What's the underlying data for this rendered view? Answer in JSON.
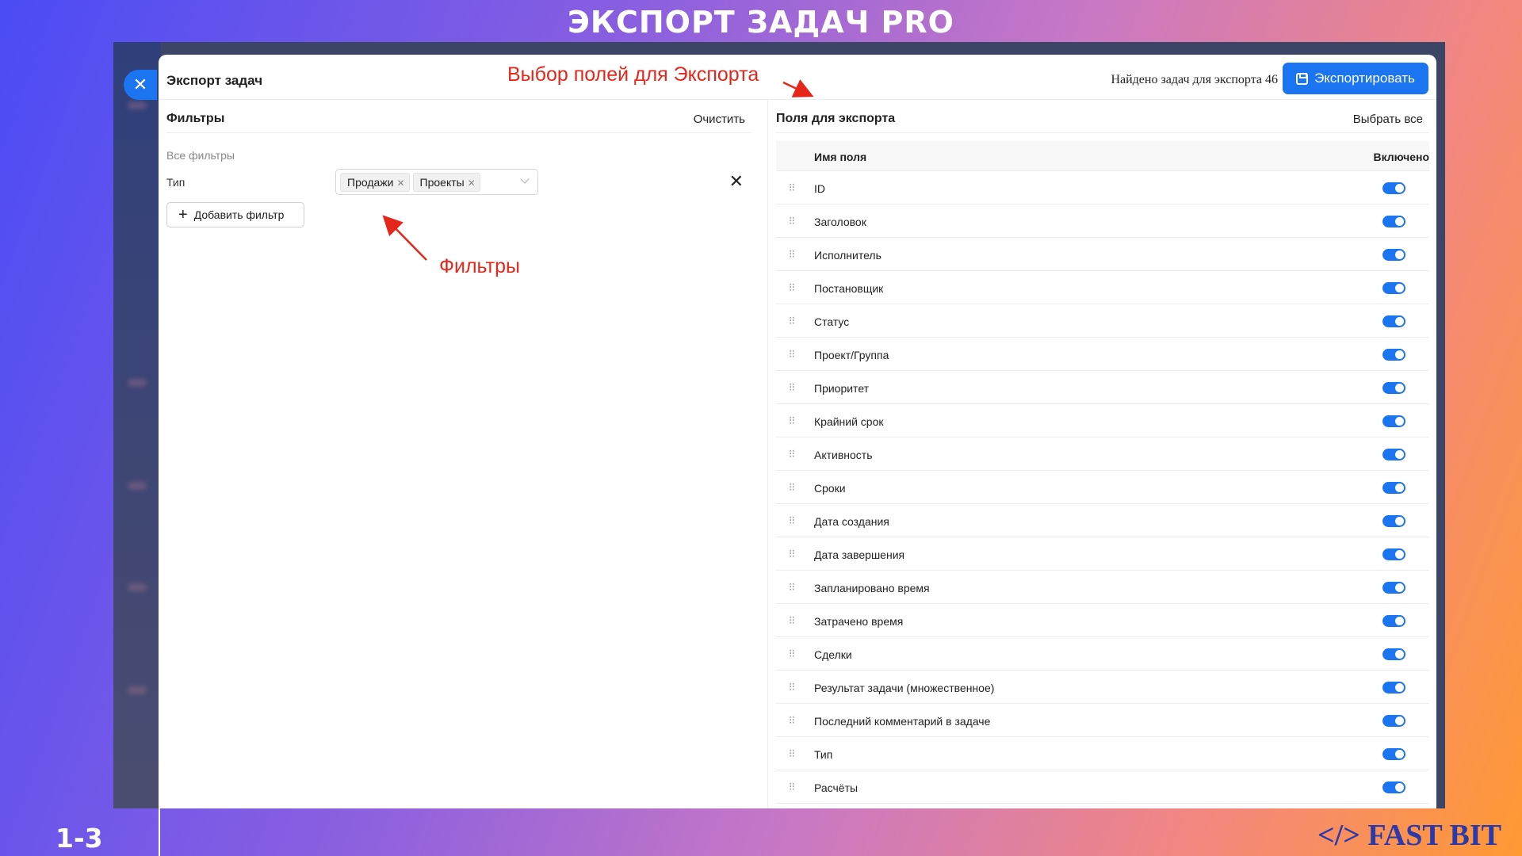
{
  "slide": {
    "title": "ЭКСПОРТ ЗАДАЧ PRO",
    "number": "1-3",
    "brand": "</> FAST BIT"
  },
  "header": {
    "title": "Экспорт задач",
    "found_text": "Найдено задач для экспорта 46",
    "export_label": "Экспортировать"
  },
  "filters": {
    "title": "Фильтры",
    "clear_label": "Очистить",
    "all_filters_label": "Все фильтры",
    "type_label": "Тип",
    "tags": [
      "Продажи",
      "Проекты"
    ],
    "add_filter_label": "Добавить фильтр"
  },
  "fields": {
    "title": "Поля для экспорта",
    "select_all_label": "Выбрать все",
    "col_name": "Имя поля",
    "col_enabled": "Включено",
    "items": [
      {
        "name": "ID",
        "enabled": true
      },
      {
        "name": "Заголовок",
        "enabled": true
      },
      {
        "name": "Исполнитель",
        "enabled": true
      },
      {
        "name": "Постановщик",
        "enabled": true
      },
      {
        "name": "Статус",
        "enabled": true
      },
      {
        "name": "Проект/Группа",
        "enabled": true
      },
      {
        "name": "Приоритет",
        "enabled": true
      },
      {
        "name": "Крайний срок",
        "enabled": true
      },
      {
        "name": "Активность",
        "enabled": true
      },
      {
        "name": "Сроки",
        "enabled": true
      },
      {
        "name": "Дата создания",
        "enabled": true
      },
      {
        "name": "Дата завершения",
        "enabled": true
      },
      {
        "name": "Запланировано время",
        "enabled": true
      },
      {
        "name": "Затрачено время",
        "enabled": true
      },
      {
        "name": "Сделки",
        "enabled": true
      },
      {
        "name": "Результат задачи (множественное)",
        "enabled": true
      },
      {
        "name": "Последний комментарий в задаче",
        "enabled": true
      },
      {
        "name": "Тип",
        "enabled": true
      },
      {
        "name": "Расчёты",
        "enabled": true
      }
    ]
  },
  "annotations": {
    "fields_note": "Выбор полей для Экспорта",
    "filters_note": "Фильтры"
  },
  "colors": {
    "accent": "#1b74f0",
    "annotation": "#e5261b"
  }
}
